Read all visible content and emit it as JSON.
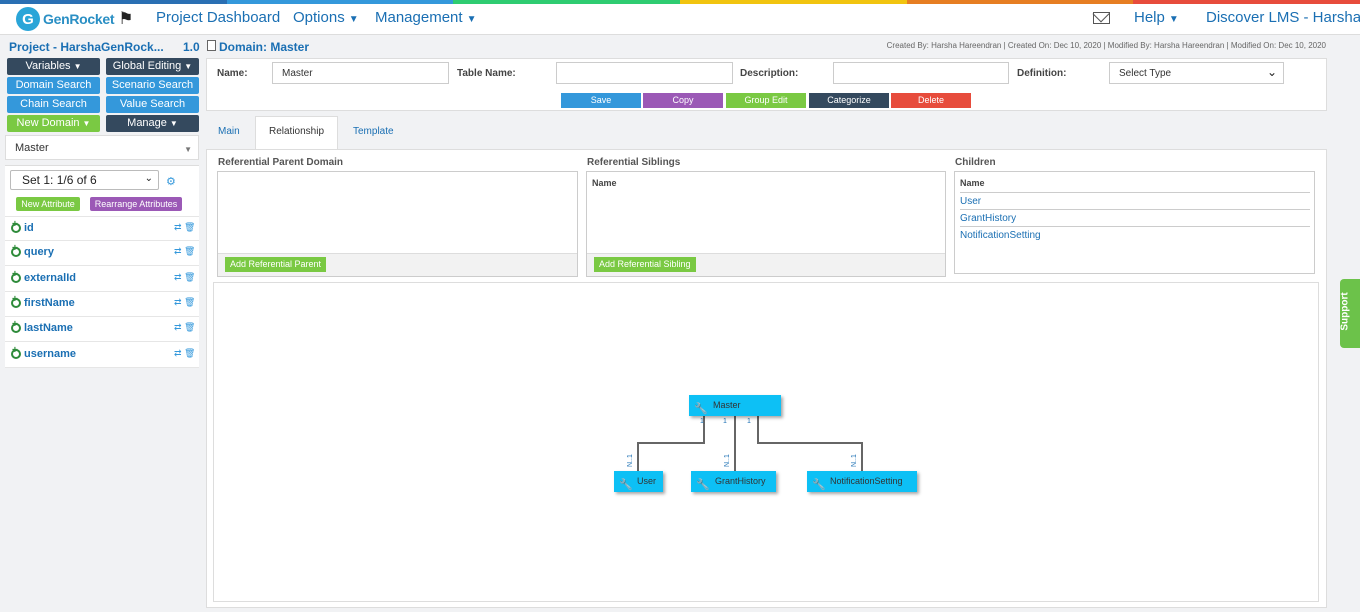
{
  "header": {
    "logo_letter": "G",
    "logo_text": "GenRocket",
    "nav": [
      "Project Dashboard",
      "Options",
      "Management"
    ],
    "help": "Help",
    "org": "Discover LMS - Harsha",
    "rainbow_colors": [
      "#2a6fb3",
      "#3498db",
      "#2ecc71",
      "#f1c40f",
      "#e67e22",
      "#e74c3c"
    ]
  },
  "sidebar": {
    "project": "Project - HarshaGenRock...",
    "version": "1.0",
    "buttons": {
      "variables": "Variables",
      "global_editing": "Global Editing",
      "domain_search": "Domain Search",
      "scenario_search": "Scenario Search",
      "chain_search": "Chain Search",
      "value_search": "Value Search",
      "new_domain": "New Domain",
      "manage": "Manage"
    },
    "selected_domain": "Master",
    "set_label": "Set 1: 1/6 of 6",
    "new_attribute": "New Attribute",
    "rearrange": "Rearrange Attributes",
    "attributes": [
      "id",
      "query",
      "externalId",
      "firstName",
      "lastName",
      "username"
    ]
  },
  "main": {
    "domain_title": "Domain: Master",
    "meta": "Created By: Harsha Hareendran | Created On: Dec 10, 2020 | Modified By: Harsha Hareendran | Modified On: Dec 10, 2020",
    "form": {
      "name_label": "Name:",
      "name_value": "Master",
      "table_label": "Table Name:",
      "table_value": "",
      "desc_label": "Description:",
      "desc_value": "",
      "def_label": "Definition:",
      "def_value": "Select Type"
    },
    "actions": {
      "save": "Save",
      "copy": "Copy",
      "group_edit": "Group Edit",
      "categorize": "Categorize",
      "delete": "Delete"
    },
    "tabs": [
      "Main",
      "Relationship",
      "Template"
    ],
    "active_tab": "Relationship",
    "relationship": {
      "parent_head": "Referential Parent Domain",
      "parent_btn": "Add Referential Parent",
      "siblings_head": "Referential Siblings",
      "siblings_col": "Name",
      "siblings_btn": "Add Referential Sibling",
      "children_head": "Children",
      "children_col": "Name",
      "children": [
        "User",
        "GrantHistory",
        "NotificationSetting"
      ]
    },
    "diagram": {
      "root": "Master",
      "children": [
        "User",
        "GrantHistory",
        "NotificationSetting"
      ],
      "parent_card": "1",
      "child_card": "N..1"
    }
  },
  "support": "Support"
}
